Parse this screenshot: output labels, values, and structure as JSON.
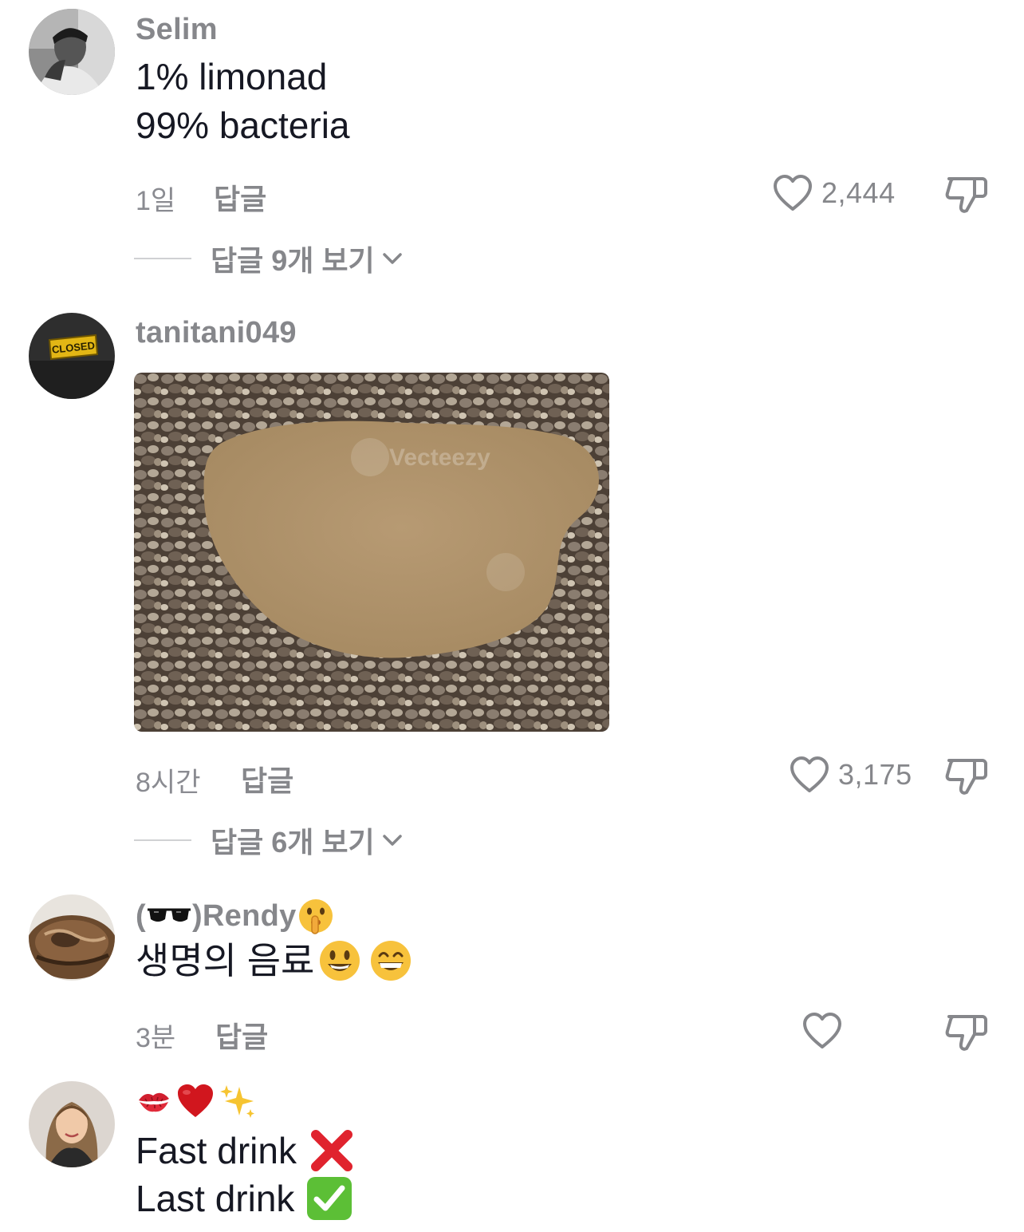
{
  "comments": [
    {
      "username": "Selim",
      "lines": [
        "1% limonad",
        "99% bacteria"
      ],
      "time": "1일",
      "reply_label": "답글",
      "likes": "2,444",
      "view_replies": "답글 9개 보기"
    },
    {
      "username": "tanitani049",
      "avatar_sign_text": "CLOSED",
      "image_icon": "muddy-puddle-photo",
      "image_watermark": "Vecteezy",
      "time": "8시간",
      "reply_label": "답글",
      "likes": "3,175",
      "view_replies": "답글 6개 보기"
    },
    {
      "username_prefix": "(",
      "username_name": ")Rendy",
      "username_icons": [
        "sunglasses-emoji",
        "shushing-face-emoji"
      ],
      "text": "생명의 음료",
      "text_icons": [
        "smiley-emoji",
        "grinning-emoji"
      ],
      "time": "3분",
      "reply_label": "답글",
      "likes": ""
    },
    {
      "username_icons": [
        "kiss-mark-emoji",
        "red-heart-emoji",
        "sparkles-emoji"
      ],
      "lines": [
        "Fast drink",
        "Last drink"
      ],
      "line_icons": [
        "cross-mark-emoji",
        "check-mark-button-emoji"
      ]
    }
  ],
  "colors": {
    "text": "#161823",
    "secondary": "#86878b",
    "divider": "#d0d1d3",
    "cross": "#e0232e",
    "check": "#5cbf36"
  }
}
